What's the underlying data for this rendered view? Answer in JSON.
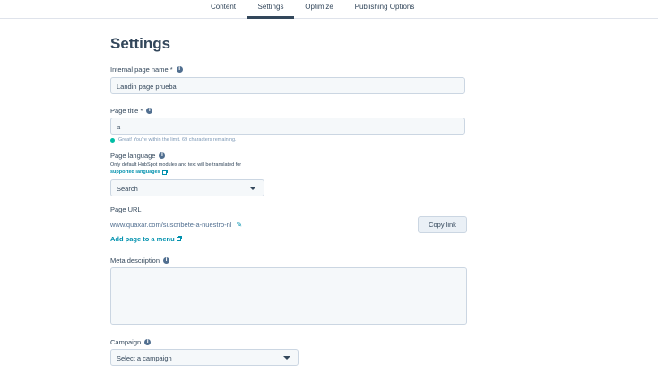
{
  "tabs": [
    {
      "label": "Content"
    },
    {
      "label": "Settings"
    },
    {
      "label": "Optimize"
    },
    {
      "label": "Publishing Options"
    }
  ],
  "page": {
    "title": "Settings"
  },
  "internal_name": {
    "label": "Internal page name *",
    "value": "Landin page prueba"
  },
  "page_title": {
    "label": "Page title *",
    "value": "a",
    "hint": "Great! You're within the limit. 69 characters remaining."
  },
  "page_language": {
    "label": "Page language",
    "note": "Only default HubSpot modules and text will be translated for",
    "link": "supported languages",
    "selected": "Search"
  },
  "page_url": {
    "label": "Page URL",
    "value": "www.quaxar.com/suscribete-a-nuestro-nl",
    "copy_button": "Copy link",
    "menu_link": "Add page to a menu"
  },
  "meta_description": {
    "label": "Meta description",
    "value": ""
  },
  "campaign": {
    "label": "Campaign",
    "selected": "Select a campaign"
  },
  "colors": {
    "text": "#33475b",
    "link": "#0091ae",
    "success": "#00bda5",
    "input_bg": "#f5f8fa",
    "border": "#cbd6e2"
  }
}
